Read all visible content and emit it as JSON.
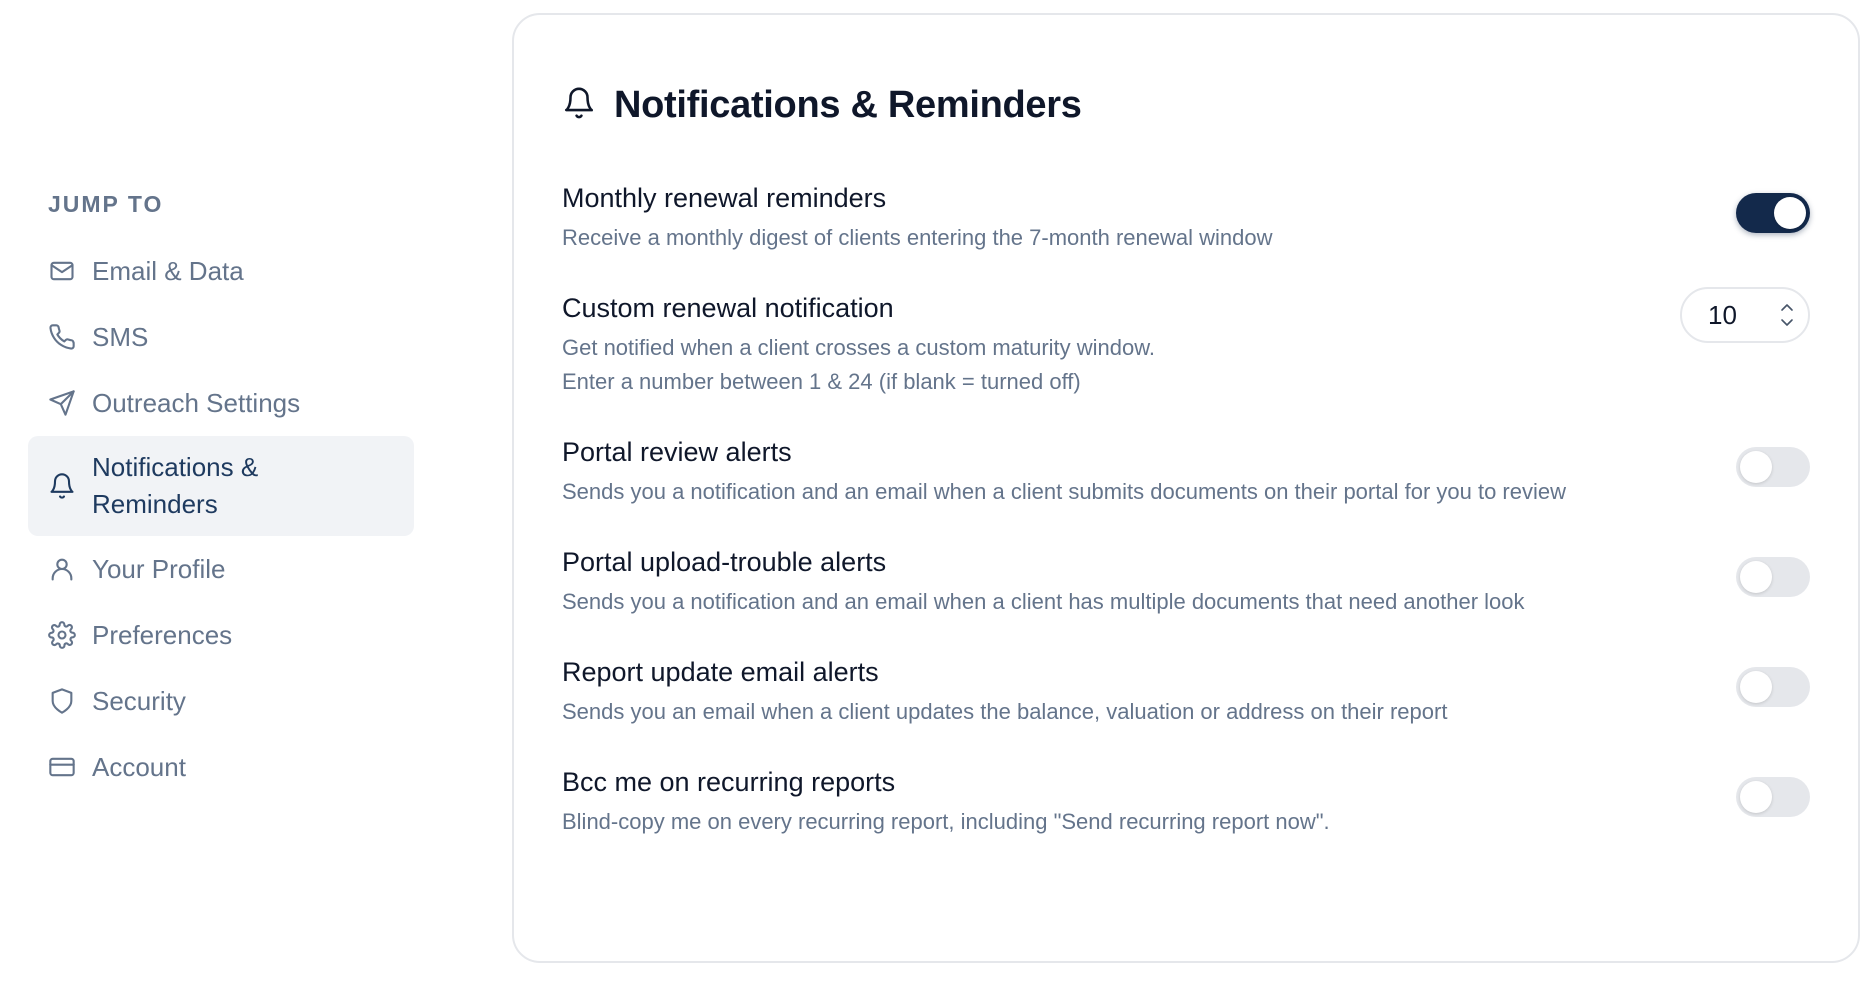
{
  "sidebar": {
    "heading": "JUMP TO",
    "items": [
      {
        "label": "Email & Data",
        "icon": "mail-icon",
        "active": false
      },
      {
        "label": "SMS",
        "icon": "phone-icon",
        "active": false
      },
      {
        "label": "Outreach Settings",
        "icon": "send-icon",
        "active": false
      },
      {
        "label": "Notifications & Reminders",
        "icon": "bell-icon",
        "active": true
      },
      {
        "label": "Your Profile",
        "icon": "user-icon",
        "active": false
      },
      {
        "label": "Preferences",
        "icon": "gear-icon",
        "active": false
      },
      {
        "label": "Security",
        "icon": "shield-icon",
        "active": false
      },
      {
        "label": "Account",
        "icon": "credit-card-icon",
        "active": false
      }
    ]
  },
  "card": {
    "title": "Notifications & Reminders",
    "icon": "bell-icon",
    "settings": [
      {
        "title": "Monthly renewal reminders",
        "description": "Receive a monthly digest of clients entering the 7-month renewal window",
        "control": "toggle",
        "enabled": true
      },
      {
        "title": "Custom renewal notification",
        "description": "Get notified when a client crosses a custom maturity window.",
        "description2": "Enter a number between 1 & 24 (if blank = turned off)",
        "control": "stepper",
        "value": "10"
      },
      {
        "title": "Portal review alerts",
        "description": "Sends you a notification and an email when a client submits documents on their portal for you to review",
        "control": "toggle",
        "enabled": false
      },
      {
        "title": "Portal upload-trouble alerts",
        "description": "Sends you a notification and an email when a client has multiple documents that need another look",
        "control": "toggle",
        "enabled": false
      },
      {
        "title": "Report update email alerts",
        "description": "Sends you an email when a client updates the balance, valuation or address on their report",
        "control": "toggle",
        "enabled": false
      },
      {
        "title": "Bcc me on recurring reports",
        "description": "Blind-copy me on every recurring report, including \"Send recurring report now\".",
        "control": "toggle",
        "enabled": false
      }
    ]
  },
  "colors": {
    "accent": "#13294b",
    "muted_text": "#64748b",
    "active_bg": "#f1f3f6",
    "border": "#e5e7eb"
  }
}
